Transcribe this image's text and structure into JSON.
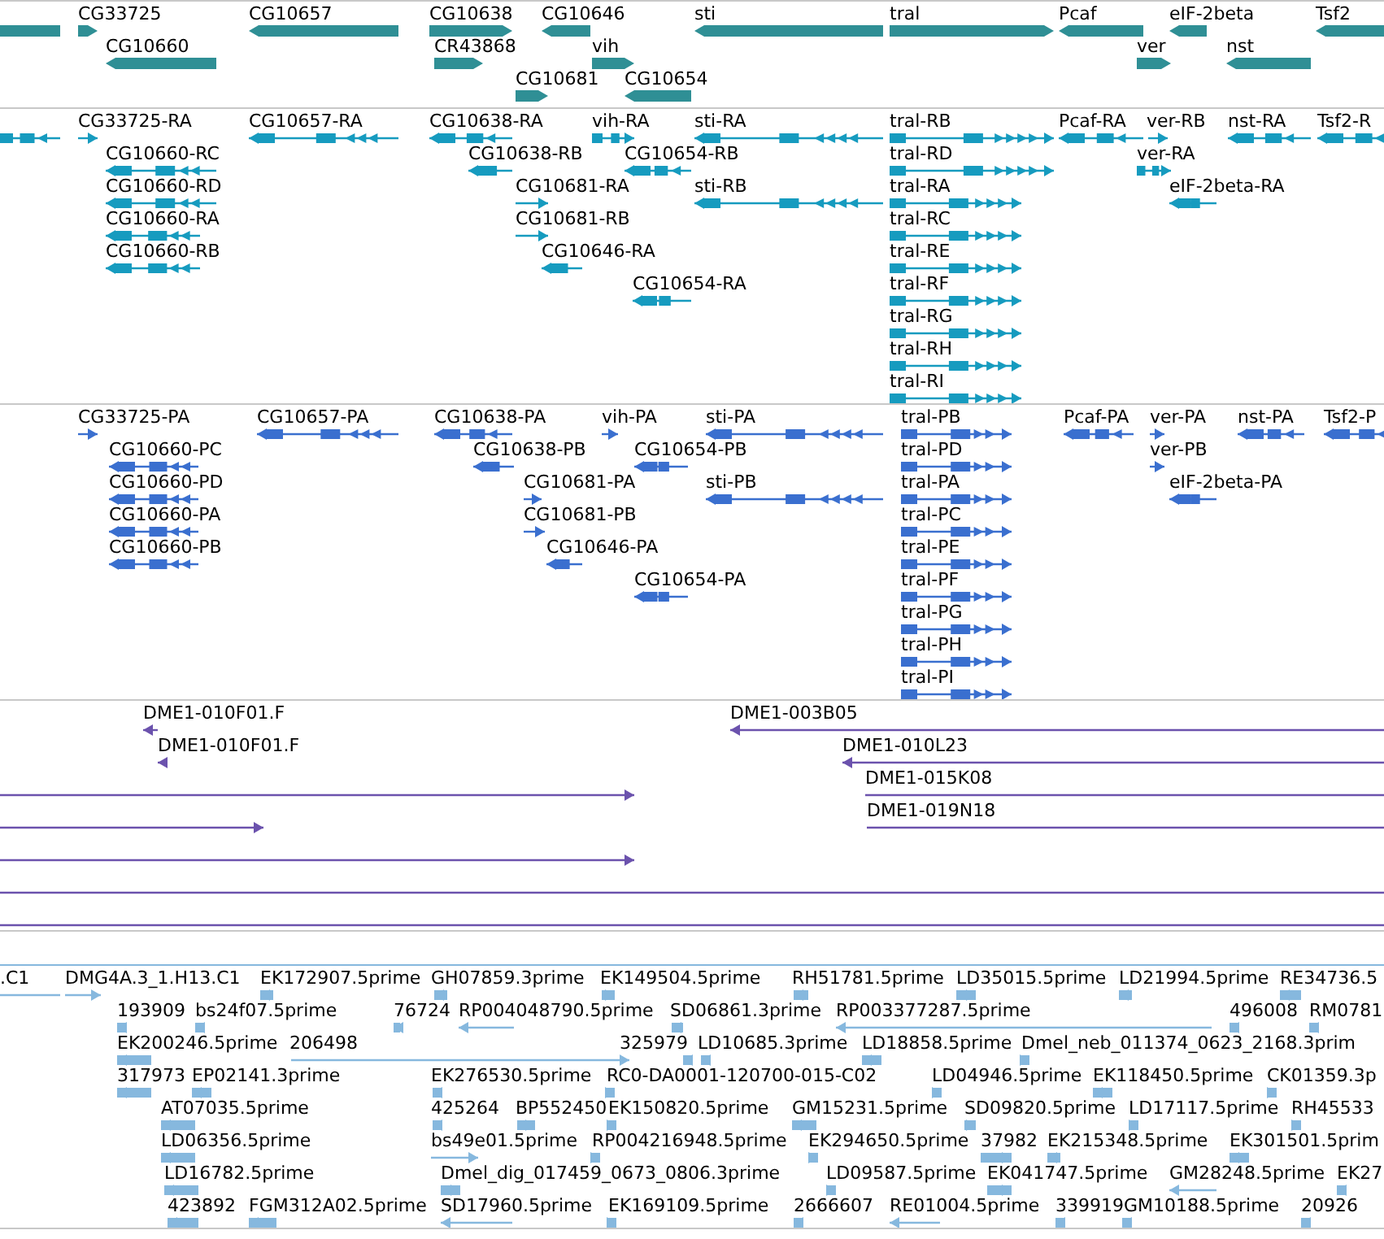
{
  "tracks": [
    {
      "kind": "gene",
      "rows": [
        {
          "features": [
            {
              "reverse": true
            },
            {
              "label": "CG33725",
              "reverse": false
            },
            {
              "label": "CG10657",
              "reverse": true
            },
            {
              "label": "CG10638",
              "reverse": false
            },
            {
              "label": "CG10646",
              "reverse": true
            },
            {
              "label": "sti",
              "reverse": true
            },
            {
              "label": "tral",
              "reverse": false
            },
            {
              "label": "Pcaf",
              "reverse": true
            },
            {
              "label": "eIF-2beta",
              "reverse": true
            },
            {
              "label": "Tsf2",
              "reverse": true
            }
          ]
        },
        {
          "features": [
            {
              "label": "CG10660",
              "reverse": true
            },
            {
              "label": "CR43868",
              "reverse": false
            },
            {
              "label": "vih",
              "reverse": false
            },
            {
              "label": "ver",
              "reverse": false
            },
            {
              "label": "nst",
              "reverse": true
            }
          ]
        },
        {
          "features": [
            {
              "label": "CG10681",
              "reverse": false
            },
            {
              "label": "CG10654",
              "reverse": true
            }
          ]
        }
      ]
    },
    {
      "kind": "transcript",
      "rows": [
        {
          "features": [
            {
              "reverse": true
            },
            {
              "label": "CG33725-RA",
              "reverse": false
            },
            {
              "label": "CG10657-RA",
              "reverse": true
            },
            {
              "label": "CG10638-RA",
              "reverse": true
            },
            {
              "label": "vih-RA",
              "reverse": false
            },
            {
              "label": "sti-RA",
              "reverse": true
            },
            {
              "label": "tral-RB",
              "reverse": false
            },
            {
              "label": "Pcaf-RA",
              "reverse": true
            },
            {
              "label": "ver-RB",
              "reverse": false
            },
            {
              "label": "nst-RA",
              "reverse": true
            },
            {
              "label": "Tsf2-R",
              "reverse": true
            }
          ]
        },
        {
          "features": [
            {
              "label": "CG10660-RC",
              "reverse": true
            },
            {
              "label": "CG10638-RB",
              "reverse": true
            },
            {
              "label": "CG10654-RB",
              "reverse": true
            },
            {
              "label": "tral-RD",
              "reverse": false
            },
            {
              "label": "ver-RA",
              "reverse": false
            }
          ]
        },
        {
          "features": [
            {
              "label": "CG10660-RD",
              "reverse": true
            },
            {
              "label": "CG10681-RA",
              "reverse": false
            },
            {
              "label": "sti-RB",
              "reverse": true
            },
            {
              "label": "tral-RA",
              "reverse": false
            },
            {
              "label": "eIF-2beta-RA",
              "reverse": true
            }
          ]
        },
        {
          "features": [
            {
              "label": "CG10660-RA",
              "reverse": true
            },
            {
              "label": "CG10681-RB",
              "reverse": false
            },
            {
              "label": "tral-RC",
              "reverse": false
            }
          ]
        },
        {
          "features": [
            {
              "label": "CG10660-RB",
              "reverse": true
            },
            {
              "label": "CG10646-RA",
              "reverse": true
            },
            {
              "label": "tral-RE",
              "reverse": false
            }
          ]
        },
        {
          "features": [
            {
              "label": "CG10654-RA",
              "reverse": true
            },
            {
              "label": "tral-RF",
              "reverse": false
            }
          ]
        },
        {
          "features": [
            {
              "label": "tral-RG",
              "reverse": false
            }
          ]
        },
        {
          "features": [
            {
              "label": "tral-RH",
              "reverse": false
            }
          ]
        },
        {
          "features": [
            {
              "label": "tral-RI",
              "reverse": false
            }
          ]
        }
      ]
    },
    {
      "kind": "protein",
      "rows": [
        {
          "features": [
            {
              "label": "CG33725-PA",
              "reverse": false
            },
            {
              "label": "CG10657-PA",
              "reverse": true
            },
            {
              "label": "CG10638-PA",
              "reverse": true
            },
            {
              "label": "vih-PA",
              "reverse": false
            },
            {
              "label": "sti-PA",
              "reverse": true
            },
            {
              "label": "tral-PB",
              "reverse": false
            },
            {
              "label": "Pcaf-PA",
              "reverse": true
            },
            {
              "label": "ver-PA",
              "reverse": false
            },
            {
              "label": "nst-PA",
              "reverse": true
            },
            {
              "label": "Tsf2-P",
              "reverse": true
            }
          ]
        },
        {
          "features": [
            {
              "label": "CG10660-PC",
              "reverse": true
            },
            {
              "label": "CG10638-PB",
              "reverse": true
            },
            {
              "label": "CG10654-PB",
              "reverse": true
            },
            {
              "label": "tral-PD",
              "reverse": false
            },
            {
              "label": "ver-PB",
              "reverse": false
            }
          ]
        },
        {
          "features": [
            {
              "label": "CG10660-PD",
              "reverse": true
            },
            {
              "label": "CG10681-PA",
              "reverse": false
            },
            {
              "label": "sti-PB",
              "reverse": true
            },
            {
              "label": "tral-PA",
              "reverse": false
            },
            {
              "label": "eIF-2beta-PA",
              "reverse": true
            }
          ]
        },
        {
          "features": [
            {
              "label": "CG10660-PA",
              "reverse": true
            },
            {
              "label": "CG10681-PB",
              "reverse": false
            },
            {
              "label": "tral-PC",
              "reverse": false
            }
          ]
        },
        {
          "features": [
            {
              "label": "CG10660-PB",
              "reverse": true
            },
            {
              "label": "CG10646-PA",
              "reverse": true
            },
            {
              "label": "tral-PE",
              "reverse": false
            }
          ]
        },
        {
          "features": [
            {
              "label": "CG10654-PA",
              "reverse": true
            },
            {
              "label": "tral-PF",
              "reverse": false
            }
          ]
        },
        {
          "features": [
            {
              "label": "tral-PG",
              "reverse": false
            }
          ]
        },
        {
          "features": [
            {
              "label": "tral-PH",
              "reverse": false
            }
          ]
        },
        {
          "features": [
            {
              "label": "tral-PI",
              "reverse": false
            }
          ]
        }
      ]
    },
    {
      "kind": "clone",
      "rows": [
        {
          "features": [
            {
              "label": "DME1-010F01.F",
              "reverse": true
            },
            {
              "label": "DME1-003B05",
              "reverse": true
            }
          ]
        },
        {
          "features": [
            {
              "label": "DME1-010F01.F",
              "reverse": true
            },
            {
              "label": "DME1-010L23",
              "reverse": true
            }
          ]
        },
        {
          "features": [
            {
              "reverse": false
            },
            {
              "label": "DME1-015K08",
              "reverse": false
            }
          ]
        },
        {
          "features": [
            {
              "reverse": false
            },
            {
              "label": "DME1-019N18",
              "reverse": false
            }
          ]
        },
        {
          "features": [
            {
              "reverse": false
            }
          ]
        }
      ]
    },
    {
      "kind": "est",
      "rows": [
        {
          "features": [
            {
              "label": ".C1",
              "reverse": true
            },
            {
              "label": "DMG4A.3_1.H13.C1",
              "reverse": false
            },
            {
              "label": "EK172907.5prime",
              "reverse": true
            },
            {
              "label": "GH07859.3prime",
              "reverse": true
            },
            {
              "label": "EK149504.5prime",
              "reverse": false
            },
            {
              "label": "RH51781.5prime",
              "reverse": true
            },
            {
              "label": "LD35015.5prime",
              "reverse": false
            },
            {
              "label": "LD21994.5prime",
              "reverse": true
            },
            {
              "label": "RE34736.5",
              "reverse": true
            }
          ]
        },
        {
          "features": [
            {
              "label": "193909",
              "reverse": true
            },
            {
              "label": "bs24f07.5prime",
              "reverse": true
            },
            {
              "label": "76724",
              "reverse": true
            },
            {
              "label": "RP004048790.5prime",
              "reverse": true
            },
            {
              "label": "SD06861.3prime",
              "reverse": true
            },
            {
              "label": "RP003377287.5prime",
              "reverse": true
            },
            {
              "label": "496008",
              "reverse": true
            },
            {
              "label": "RM0781",
              "reverse": true
            }
          ]
        },
        {
          "features": [
            {
              "label": "EK200246.5prime",
              "reverse": true
            },
            {
              "label": "206498",
              "reverse": false
            },
            {
              "label": "325979",
              "reverse": true
            },
            {
              "label": "LD10685.3prime",
              "reverse": true
            },
            {
              "label": "LD18858.5prime",
              "reverse": true
            },
            {
              "label": "Dmel_neb_011374_0623_2168.3prim",
              "reverse": false
            }
          ]
        },
        {
          "features": [
            {
              "label": "317973",
              "reverse": true
            },
            {
              "label": "EP02141.3prime",
              "reverse": true
            },
            {
              "label": "EK276530.5prime",
              "reverse": true
            },
            {
              "label": "RC0-DA0001-120700-015-C02",
              "reverse": false
            },
            {
              "label": "LD04946.5prime",
              "reverse": false
            },
            {
              "label": "EK118450.5prime",
              "reverse": true
            },
            {
              "label": "CK01359.3p",
              "reverse": false
            }
          ]
        },
        {
          "features": [
            {
              "label": "AT07035.5prime",
              "reverse": true
            },
            {
              "label": "425264",
              "reverse": true
            },
            {
              "label": "BP552450",
              "reverse": false
            },
            {
              "label": "EK150820.5prime",
              "reverse": false
            },
            {
              "label": "GM15231.5prime",
              "reverse": true
            },
            {
              "label": "SD09820.5prime",
              "reverse": false
            },
            {
              "label": "LD17117.5prime",
              "reverse": false
            },
            {
              "label": "RH45533",
              "reverse": false
            }
          ]
        },
        {
          "features": [
            {
              "label": "LD06356.5prime",
              "reverse": true
            },
            {
              "label": "bs49e01.5prime",
              "reverse": false
            },
            {
              "label": "RP004216948.5prime",
              "reverse": false
            },
            {
              "label": "EK294650.5prime",
              "reverse": false
            },
            {
              "label": "37982",
              "reverse": false
            },
            {
              "label": "EK215348.5prime",
              "reverse": true
            },
            {
              "label": "EK301501.5prim",
              "reverse": true
            }
          ]
        },
        {
          "features": [
            {
              "label": "LD16782.5prime",
              "reverse": true
            },
            {
              "label": "Dmel_dig_017459_0673_0806.3prime",
              "reverse": false
            },
            {
              "label": "LD09587.5prime",
              "reverse": false
            },
            {
              "label": "EK041747.5prime",
              "reverse": false
            },
            {
              "label": "GM28248.5prime",
              "reverse": true
            },
            {
              "label": "EK27",
              "reverse": true
            }
          ]
        },
        {
          "features": [
            {
              "label": "423892",
              "reverse": true
            },
            {
              "label": "FGM312A02.5prime",
              "reverse": true
            },
            {
              "label": "SD17960.5prime",
              "reverse": true
            },
            {
              "label": "EK169109.5prime",
              "reverse": false
            },
            {
              "label": "2666607",
              "reverse": true
            },
            {
              "label": "RE01004.5prime",
              "reverse": true
            },
            {
              "label": "339919",
              "reverse": true
            },
            {
              "label": "GM10188.5prime",
              "reverse": true
            },
            {
              "label": "20926",
              "reverse": true
            }
          ]
        }
      ]
    }
  ]
}
